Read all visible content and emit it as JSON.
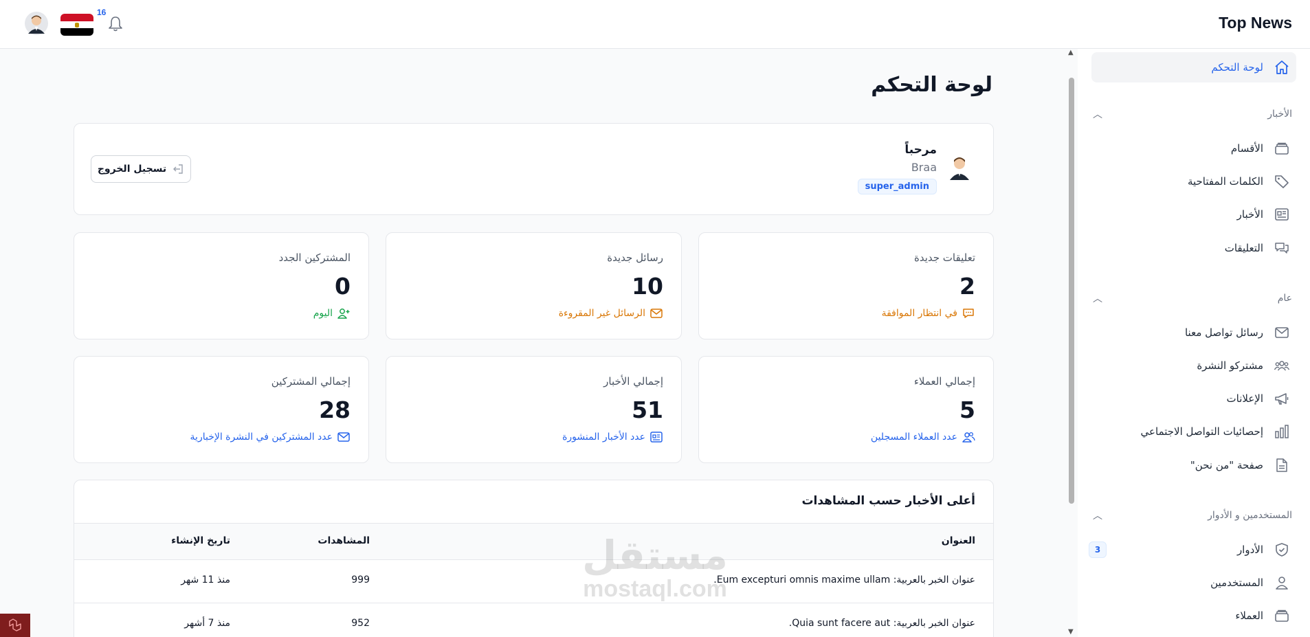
{
  "brand": "Top News",
  "header": {
    "notification_count": "16"
  },
  "sidebar": {
    "dashboard": "لوحة التحكم",
    "group_news": "الأخبار",
    "categories": "الأقسام",
    "keywords": "الكلمات المفتاحية",
    "news": "الأخبار",
    "comments": "التعليقات",
    "group_general": "عام",
    "contact_messages": "رسائل تواصل معنا",
    "newsletter_subscribers": "مشتركو النشرة",
    "ads": "الإعلانات",
    "social_stats": "إحصائيات التواصل الاجتماعي",
    "about_page": "صفحة \"من نحن\"",
    "group_users_roles": "المستخدمين و الأدوار",
    "roles": "الأدوار",
    "roles_badge": "3",
    "users": "المستخدمين",
    "clients": "العملاء"
  },
  "page": {
    "title": "لوحة التحكم"
  },
  "welcome": {
    "greeting": "مرحباً",
    "username": "Braa",
    "role": "super_admin",
    "logout_label": "تسجيل الخروج"
  },
  "stats": {
    "new_comments": {
      "title": "تعليقات جديدة",
      "value": "2",
      "sub": "في انتظار الموافقة"
    },
    "new_messages": {
      "title": "رسائل جديدة",
      "value": "10",
      "sub": "الرسائل غير المقروءة"
    },
    "new_subscribers": {
      "title": "المشتركين الجدد",
      "value": "0",
      "sub": "اليوم"
    },
    "total_clients": {
      "title": "إجمالي العملاء",
      "value": "5",
      "sub": "عدد العملاء المسجلين"
    },
    "total_news": {
      "title": "إجمالي الأخبار",
      "value": "51",
      "sub": "عدد الأخبار المنشورة"
    },
    "total_subscribers": {
      "title": "إجمالي المشتركين",
      "value": "28",
      "sub": "عدد المشتركين في النشرة الإخبارية"
    }
  },
  "top_news": {
    "heading": "أعلى الأخبار حسب المشاهدات",
    "columns": {
      "title": "العنوان",
      "views": "المشاهدات",
      "created": "تاريخ الإنشاء"
    },
    "rows": [
      {
        "title": "عنوان الخبر بالعربية: Eum excepturi omnis maxime ullam.",
        "views": "999",
        "created": "منذ 11 شهر"
      },
      {
        "title": "عنوان الخبر بالعربية: Quia sunt facere aut.",
        "views": "952",
        "created": "منذ 7 أشهر"
      }
    ]
  },
  "watermark": {
    "arabic": "مستقل",
    "latin": "mostaql.com"
  },
  "colors": {
    "accent": "#2563eb",
    "warning": "#d97706",
    "success": "#16a34a"
  }
}
